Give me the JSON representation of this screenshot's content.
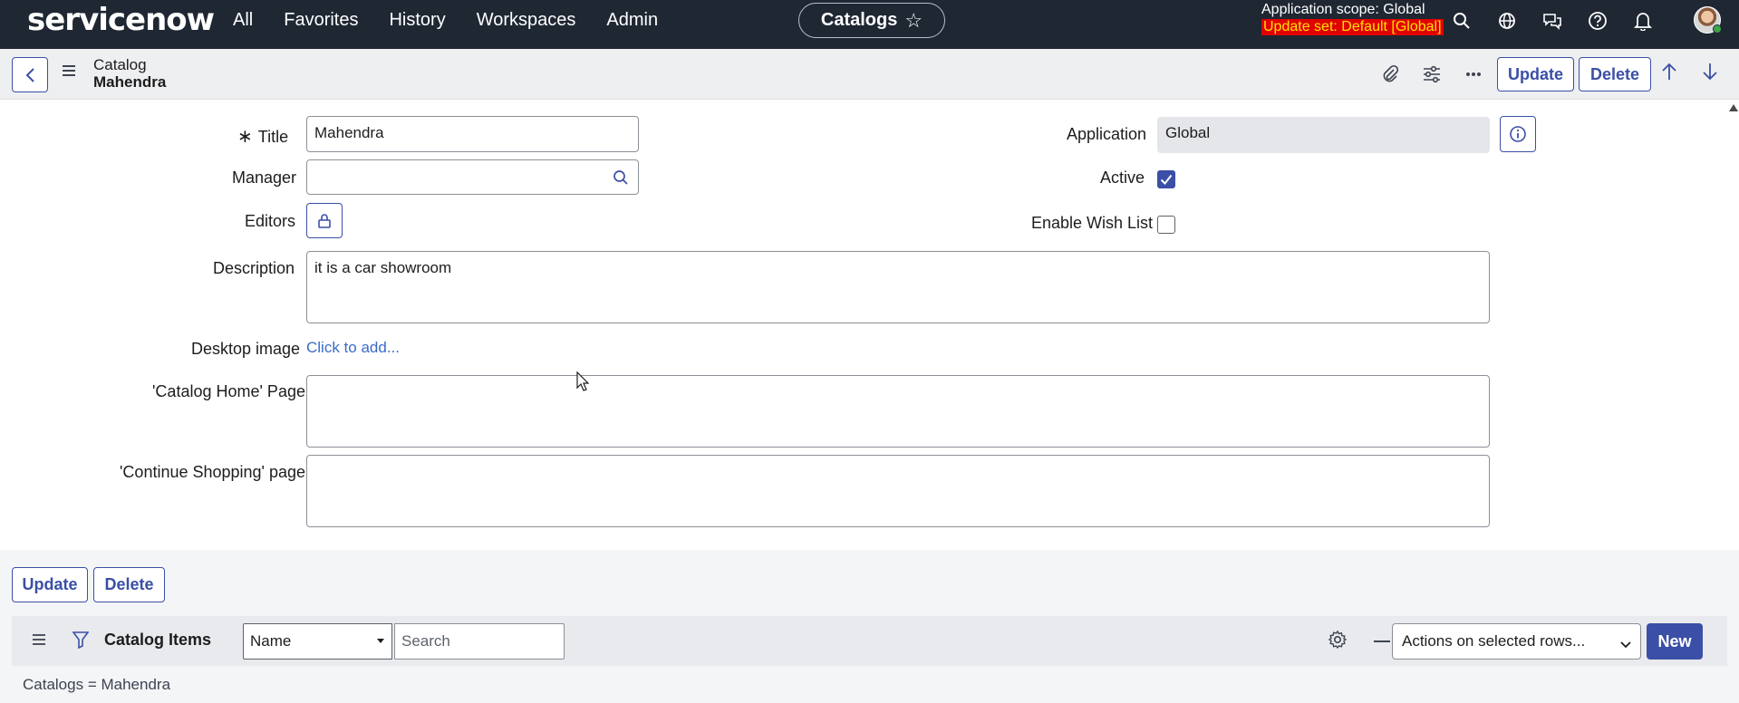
{
  "topnav": {
    "logo": "servicenow",
    "links": [
      "All",
      "Favorites",
      "History",
      "Workspaces",
      "Admin"
    ],
    "context_pill": "Catalogs",
    "scope_line1": "Application scope: Global",
    "scope_line2": "Update set: Default [Global]",
    "icons": [
      "search-icon",
      "globe-icon",
      "chat-icon",
      "help-icon",
      "bell-icon"
    ]
  },
  "header": {
    "record_type": "Catalog",
    "record_name": "Mahendra",
    "update_label": "Update",
    "delete_label": "Delete"
  },
  "form": {
    "title_label": "Title",
    "title_value": "Mahendra",
    "manager_label": "Manager",
    "manager_value": "",
    "editors_label": "Editors",
    "application_label": "Application",
    "application_value": "Global",
    "active_label": "Active",
    "active_checked": true,
    "wishlist_label": "Enable Wish List",
    "wishlist_checked": false,
    "description_label": "Description",
    "description_value": "it is a car showroom",
    "desktop_image_label": "Desktop image",
    "desktop_image_link": "Click to add...",
    "catalog_home_label": "'Catalog Home' Page",
    "catalog_home_value": "",
    "continue_shopping_label": "'Continue Shopping' page",
    "continue_shopping_value": ""
  },
  "footer_buttons": {
    "update_label": "Update",
    "delete_label": "Delete"
  },
  "related_list": {
    "title": "Catalog Items",
    "search_field": "Name",
    "search_placeholder": "Search",
    "actions_label": "Actions on selected rows...",
    "new_label": "New",
    "breadcrumb": "Catalogs = Mahendra"
  },
  "colors": {
    "nav_bg": "#1f2733",
    "accent": "#3b4fa6",
    "update_set_bg": "#e00000",
    "update_set_fg": "#ffe300"
  }
}
